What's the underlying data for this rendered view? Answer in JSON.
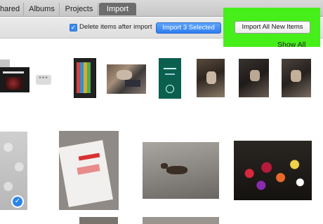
{
  "tabs": [
    {
      "label": "hared"
    },
    {
      "label": "Albums"
    },
    {
      "label": "Projects"
    },
    {
      "label": "Import"
    }
  ],
  "toolbar": {
    "delete_checkbox_checked": true,
    "delete_label": "Delete items after import",
    "import_selected_label": "Import 3 Selected",
    "import_all_label": "Import All New Items"
  },
  "content": {
    "show_all_label": "Show All",
    "more_indicator": "•••",
    "selected_check": "✓"
  },
  "colors": {
    "highlight": "#46ef1a",
    "accent_blue": "#2f7df0",
    "active_tab": "#6d6d6d"
  }
}
